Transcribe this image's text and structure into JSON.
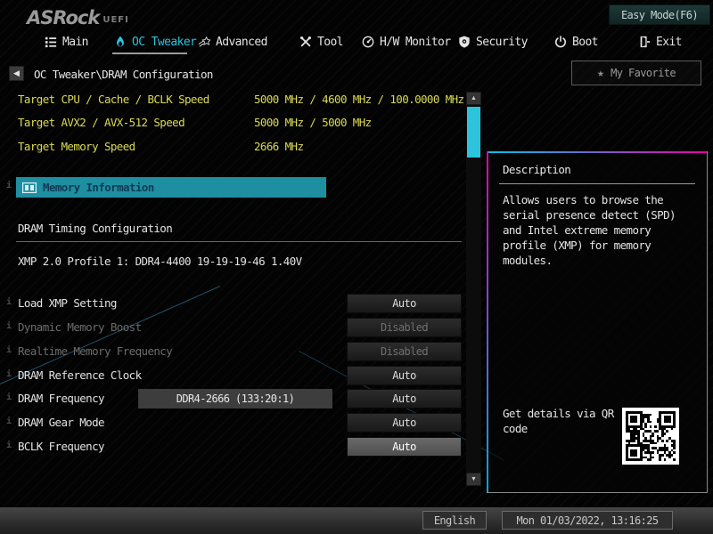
{
  "header": {
    "logo": "ASRock",
    "logo_suffix": "UEFI",
    "easy_mode_button": "Easy Mode(F6)",
    "tabs": [
      {
        "label": "Main"
      },
      {
        "label": "OC Tweaker",
        "active": true
      },
      {
        "label": "Advanced"
      },
      {
        "label": "Tool"
      },
      {
        "label": "H/W Monitor"
      },
      {
        "label": "Security"
      },
      {
        "label": "Boot"
      },
      {
        "label": "Exit"
      }
    ]
  },
  "breadcrumb": {
    "path": "OC Tweaker\\DRAM Configuration",
    "favorite_button": "My Favorite"
  },
  "info_rows": [
    {
      "label": "Target CPU / Cache / BCLK Speed",
      "value": "5000 MHz / 4600 MHz / 100.0000 MHz"
    },
    {
      "label": "Target AVX2 / AVX-512 Speed",
      "value": "5000 MHz / 5000 MHz"
    },
    {
      "label": "Target Memory Speed",
      "value": "2666 MHz"
    }
  ],
  "memory_information_label": "Memory Information",
  "section": {
    "title": "DRAM Timing Configuration",
    "subtitle": "XMP 2.0 Profile 1: DDR4-4400 19-19-19-46 1.40V"
  },
  "settings": [
    {
      "label": "Load XMP Setting",
      "value": "Auto",
      "state": "normal"
    },
    {
      "label": "Dynamic Memory Boost",
      "value": "Disabled",
      "state": "disabled"
    },
    {
      "label": "Realtime Memory Frequency",
      "value": "Disabled",
      "state": "disabled"
    },
    {
      "label": "DRAM Reference Clock",
      "value": "Auto",
      "state": "normal"
    },
    {
      "label": "DRAM Frequency",
      "value": "Auto",
      "extra": "DDR4-2666 (133:20:1)",
      "state": "normal"
    },
    {
      "label": "DRAM Gear Mode",
      "value": "Auto",
      "state": "normal"
    },
    {
      "label": "BCLK Frequency",
      "value": "Auto",
      "state": "selected"
    }
  ],
  "description_panel": {
    "title": "Description",
    "body": "Allows users to browse the serial presence detect (SPD) and Intel extreme memory profile (XMP) for memory modules.",
    "qr_label": "Get details via QR code"
  },
  "footer": {
    "language_button": "English",
    "datetime": "Mon 01/03/2022, 13:16:25"
  },
  "colors": {
    "accent": "#2cc4dd",
    "info-yellow": "#dada52",
    "teal": "#1e8fa0",
    "magenta": "#e800a8"
  }
}
